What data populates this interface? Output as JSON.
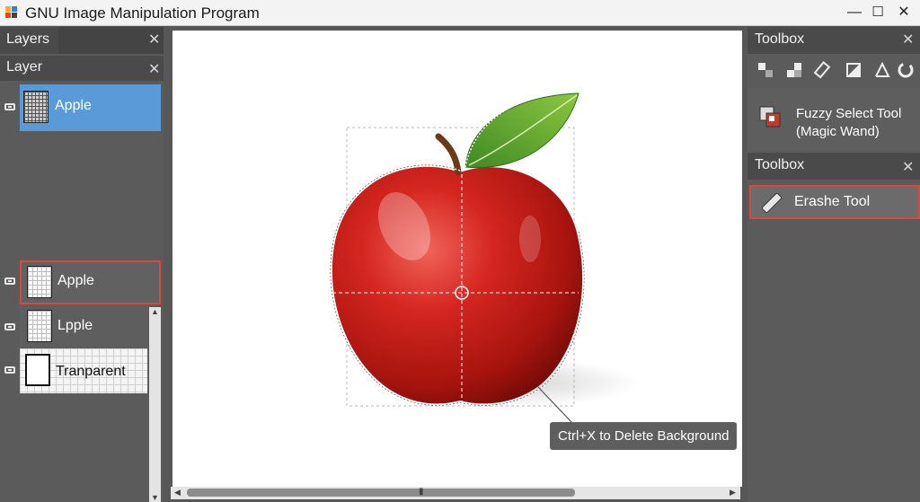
{
  "window": {
    "title": "GNU Image Manipulation Program"
  },
  "left_panel": {
    "tab_label": "Layers",
    "sub_header": "Layer",
    "layers": [
      {
        "label": "Apple"
      },
      {
        "label": "Apple"
      },
      {
        "label": "Lpple"
      },
      {
        "label": "Tranparent"
      }
    ]
  },
  "right_panel": {
    "toolbox_header_1": "Toolbox",
    "toolbox_header_2": "Toolbox",
    "fuzzy_tool": {
      "line1": "Fuzzy Select Tool",
      "line2": "(Magic Wand)"
    },
    "erase_tool": {
      "label": "Erashe Tool"
    },
    "tool_icons": [
      "rect-select-icon",
      "color-select-icon",
      "eraser-icon",
      "fill-icon",
      "measure-icon",
      "rotate-icon"
    ]
  },
  "canvas": {
    "tooltip": "Ctrl+X to Delete Background"
  },
  "colors": {
    "highlight_red": "#d9483f",
    "selected_blue": "#5b9ad8"
  }
}
